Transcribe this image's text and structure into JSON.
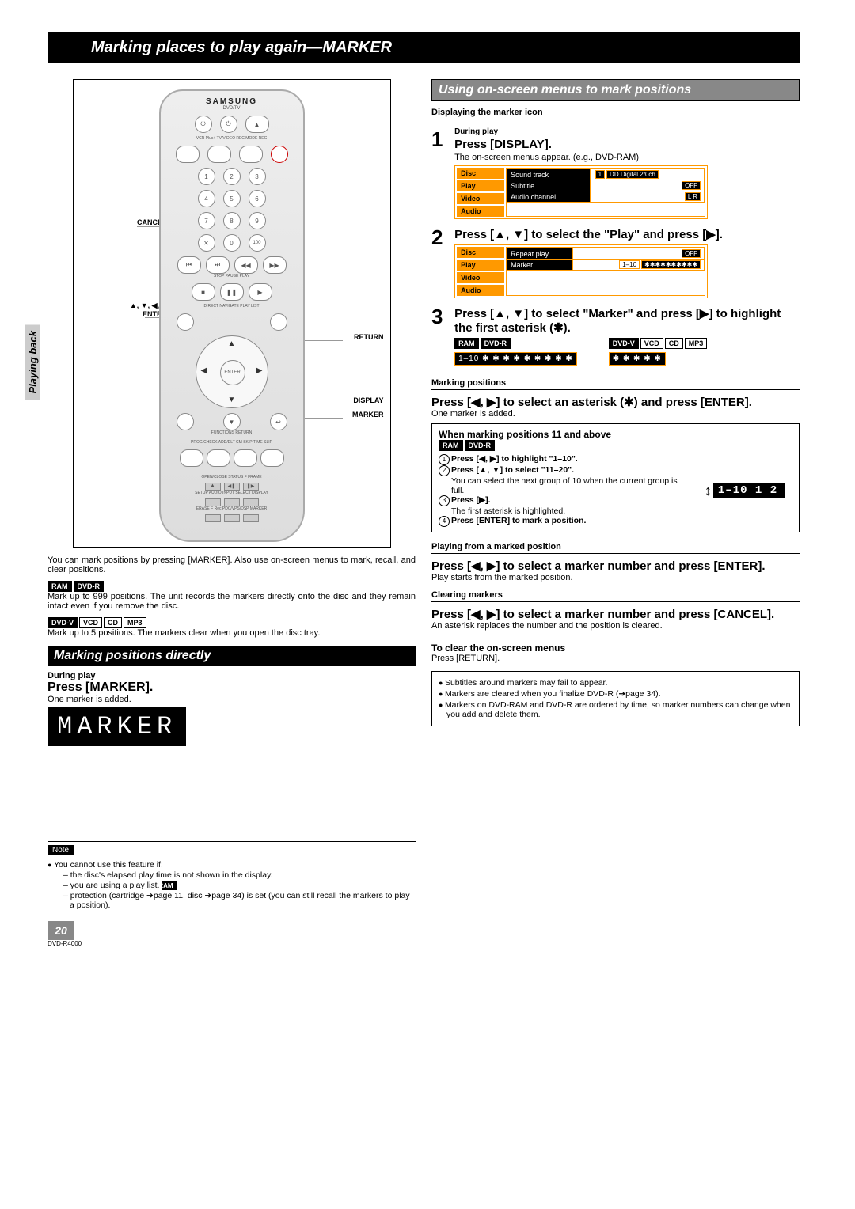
{
  "title": "Marking places to play again—MARKER",
  "side_tab": "Playing back",
  "page_number": "20",
  "model": "DVD-R4000",
  "remote": {
    "brand": "SAMSUNG",
    "sub": "DVD/TV",
    "callouts": {
      "cancel": "CANCEL",
      "arrows_enter": "▲, ▼, ◀, ▶\nENTER",
      "return": "RETURN",
      "display": "DISPLAY",
      "marker": "MARKER"
    }
  },
  "left": {
    "intro": "You can mark positions by pressing [MARKER]. Also use on-screen menus to mark, recall, and clear positions.",
    "ram_dvr_text": "Mark up to 999 positions. The unit records the markers directly onto the disc and they remain intact even if you remove the disc.",
    "other_text": "Mark up to 5 positions. The markers clear when you open the disc tray.",
    "section_direct": "Marking positions directly",
    "during_play": "During play",
    "press_marker": "Press [MARKER].",
    "one_added": "One marker is added.",
    "marker_display": "MARKER"
  },
  "badges": {
    "ram": "RAM",
    "dvdr": "DVD-R",
    "dvdv": "DVD-V",
    "vcd": "VCD",
    "cd": "CD",
    "mp3": "MP3"
  },
  "right": {
    "banner": "Using on-screen menus to mark positions",
    "sub_display": "Displaying the marker icon",
    "step1": {
      "num": "1",
      "pre": "During play",
      "main": "Press [DISPLAY].",
      "post": "The on-screen menus appear. (e.g., DVD-RAM)"
    },
    "osd1": {
      "tabs": [
        "Disc",
        "Play",
        "Video",
        "Audio"
      ],
      "rows": [
        {
          "l": "Sound track",
          "c": "1",
          "r": "DD Digital 2/0ch"
        },
        {
          "l": "Subtitle",
          "c": "",
          "r": "OFF"
        },
        {
          "l": "Audio channel",
          "c": "",
          "r": "L R"
        }
      ]
    },
    "step2": {
      "num": "2",
      "main": "Press [▲, ▼] to select the \"Play\" and press [▶]."
    },
    "osd2": {
      "tabs": [
        "Disc",
        "Play",
        "Video",
        "Audio"
      ],
      "rows": [
        {
          "l": "Repeat play",
          "r": "OFF"
        },
        {
          "l": "Marker",
          "r": "1–10  ✱✱✱✱✱✱✱✱✱✱"
        }
      ]
    },
    "step3": {
      "num": "3",
      "main": "Press [▲, ▼] to select \"Marker\" and press [▶] to highlight the first asterisk (✱)."
    },
    "marker_bar_a": "1–10  ✱ ✱ ✱ ✱ ✱ ✱ ✱ ✱ ✱",
    "marker_bar_b": "✱ ✱ ✱ ✱ ✱",
    "sub_marking": "Marking positions",
    "press_select_ast": "Press [◀, ▶] to select an asterisk (✱) and press [ENTER].",
    "one_added": "One marker is added.",
    "box11": {
      "title": "When marking positions 11 and above",
      "l1": "Press [◀, ▶] to highlight \"1–10\".",
      "l2": "Press [▲, ▼] to select \"11–20\".",
      "l2b": "You can select the next group of 10 when the current group is full.",
      "l3": "Press [▶].",
      "l3b": "The first asterisk is highlighted.",
      "l4": "Press [ENTER] to mark a position.",
      "badge": "1–10   1 2",
      "arrow": "↕"
    },
    "sub_playing": "Playing from a marked position",
    "play_cmd": "Press [◀, ▶] to select a marker number and press [ENTER].",
    "play_text": "Play starts from the marked position.",
    "sub_clearing": "Clearing markers",
    "clear_cmd": "Press [◀, ▶] to select a marker number and press [CANCEL].",
    "clear_text": "An asterisk replaces the number and the position is cleared.",
    "clear_osd": "To clear the on-screen menus",
    "clear_osd_text": "Press [RETURN].",
    "notes": [
      "Subtitles around markers may fail to appear.",
      "Markers are cleared when you finalize DVD-R (➔page 34).",
      "Markers on DVD-RAM and DVD-R are ordered by time, so marker numbers can change when you add and delete them."
    ]
  },
  "note_box": {
    "label": "Note",
    "lead": "You cannot use this feature if:",
    "items": [
      "the disc's elapsed play time is not shown in the display.",
      "you are using a play list.",
      "protection (cartridge ➔page 11, disc ➔page 34) is set (you can still recall the markers to play a position)."
    ]
  }
}
